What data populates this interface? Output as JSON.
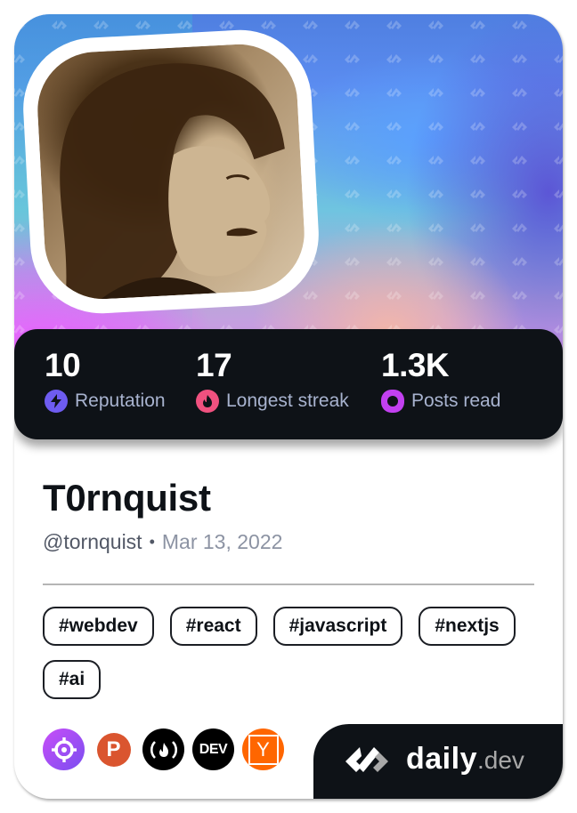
{
  "profile": {
    "display_name": "T0rnquist",
    "handle": "@tornquist",
    "separator": "•",
    "joined_date": "Mar 13, 2022",
    "avatar_alt": "Profile photo of T0rnquist"
  },
  "stats": [
    {
      "value": "10",
      "label": "Reputation",
      "icon": "lightning-icon",
      "color": "#6e5cf0"
    },
    {
      "value": "17",
      "label": "Longest streak",
      "icon": "flame-icon",
      "color": "#f0517f"
    },
    {
      "value": "1.3K",
      "label": "Posts read",
      "icon": "eye-ring-icon",
      "color": "#c240f0"
    }
  ],
  "tags": [
    "#webdev",
    "#react",
    "#javascript",
    "#nextjs",
    "#ai"
  ],
  "sources": [
    {
      "name": "crosshair-source",
      "icon": "crosshair-icon",
      "color": "#9b4ef5"
    },
    {
      "name": "product-hunt",
      "icon": "product-hunt-icon",
      "glyph": "P",
      "color": "#da552f"
    },
    {
      "name": "freecodecamp",
      "icon": "freecodecamp-icon",
      "glyph": "(🔥)",
      "color": "#000000"
    },
    {
      "name": "dev-to",
      "icon": "dev-icon",
      "glyph": "DEV",
      "color": "#000000"
    },
    {
      "name": "hacker-news",
      "icon": "hacker-news-icon",
      "glyph": "Y",
      "color": "#ff6600"
    }
  ],
  "brand": {
    "name": "daily",
    "tld": ".dev"
  },
  "colors": {
    "dark": "#0e1217",
    "stat_label": "#a8b3cf",
    "handle": "#525866",
    "date": "#8c93a3"
  }
}
